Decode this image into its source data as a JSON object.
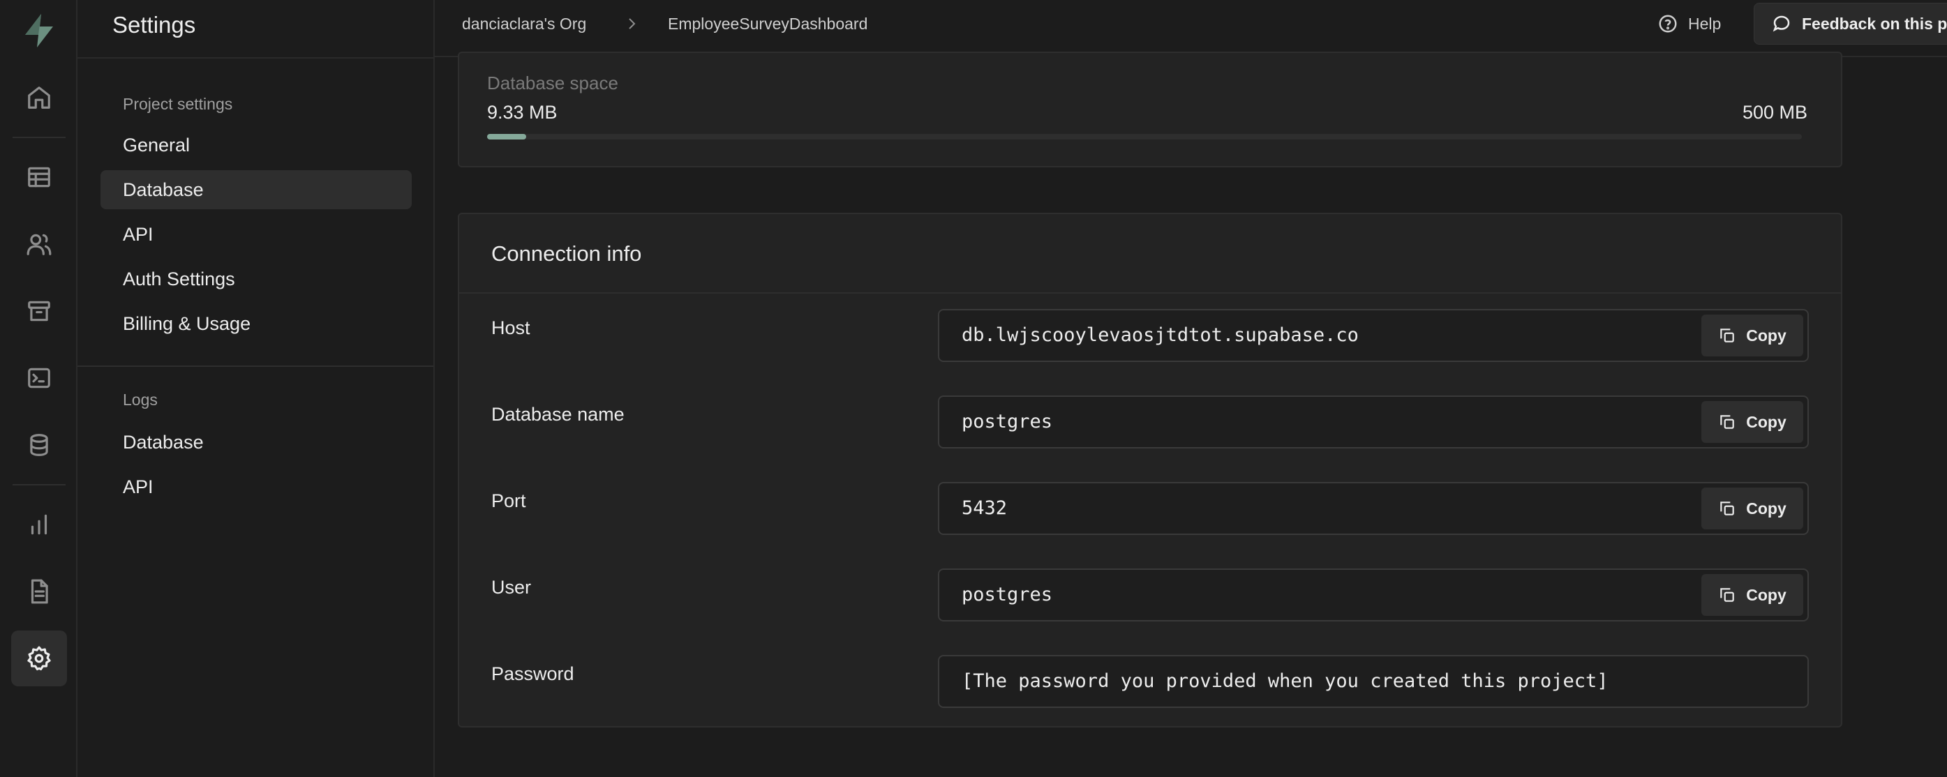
{
  "header": {
    "section_title": "Settings",
    "breadcrumbs": [
      "danciaclara's Org",
      "EmployeeSurveyDashboard"
    ],
    "help_label": "Help",
    "feedback_label": "Feedback on this page"
  },
  "rail": {
    "icons": [
      "supabase-logo",
      "home-icon",
      "table-editor-icon",
      "users-icon",
      "storage-icon",
      "sql-terminal-icon",
      "database-icon",
      "reports-icon",
      "api-docs-icon",
      "settings-icon"
    ],
    "active": "settings-icon"
  },
  "sidebar": {
    "project_settings_label": "Project settings",
    "items": [
      "General",
      "Database",
      "API",
      "Auth Settings",
      "Billing & Usage"
    ],
    "active_item": "Database",
    "logs_label": "Logs",
    "log_items": [
      "Database",
      "API"
    ]
  },
  "database_space": {
    "label": "Database space",
    "used": "9.33 MB",
    "total": "500  MB",
    "used_fraction": 0.0187
  },
  "connection_info": {
    "title": "Connection info",
    "copy_label": "Copy",
    "rows": [
      {
        "label": "Host",
        "value": "db.lwjscooylevaosjtdtot.supabase.co"
      },
      {
        "label": "Database name",
        "value": "postgres"
      },
      {
        "label": "Port",
        "value": "5432"
      },
      {
        "label": "User",
        "value": "postgres"
      },
      {
        "label": "Password",
        "value": "[The password you provided when you created this project]"
      }
    ]
  },
  "colors": {
    "background": "#1c1c1c",
    "panel": "#232323",
    "accent": "#85a99a"
  }
}
